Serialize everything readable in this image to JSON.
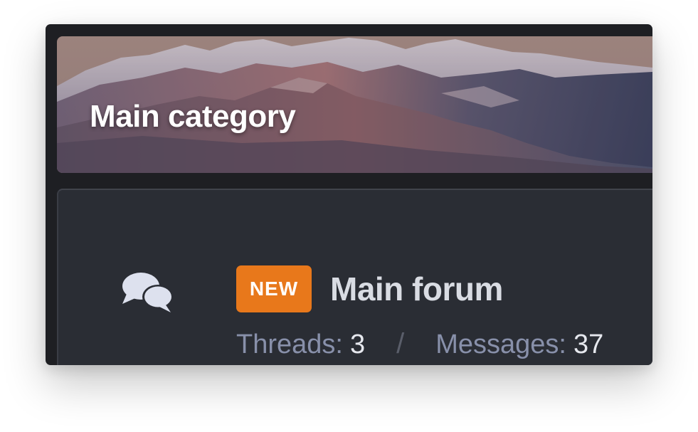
{
  "category": {
    "title": "Main category"
  },
  "forum": {
    "badge": "NEW",
    "title": "Main forum",
    "icon": "comments-icon",
    "stats": {
      "threads_label": "Threads:",
      "threads_value": "3",
      "separator": "/",
      "messages_label": "Messages:",
      "messages_value": "37"
    }
  },
  "colors": {
    "badge": "#e8781b",
    "panel": "#2a2d34",
    "window": "#1e1f23",
    "stat_label": "#8890aa"
  }
}
